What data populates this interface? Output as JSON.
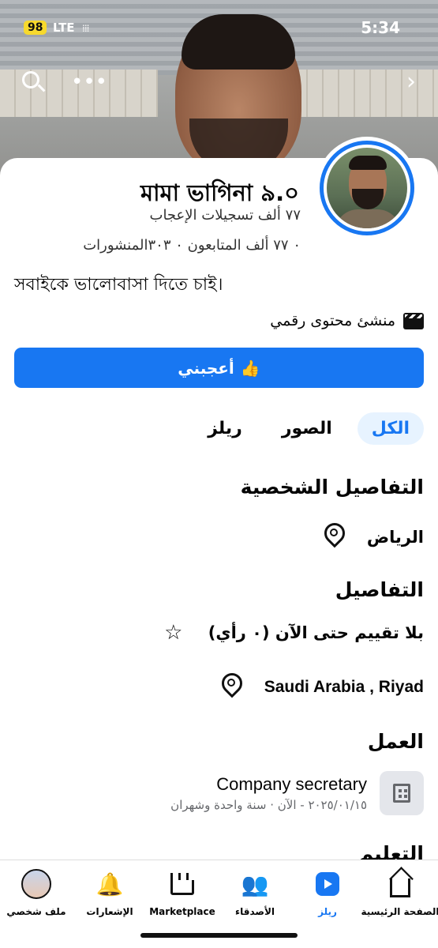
{
  "status_bar": {
    "battery": "98",
    "network": "LTE",
    "signal": "⁞⁞⁞",
    "time": "5:34"
  },
  "profile": {
    "name": "মামা ভাগিনা ৯.০",
    "likes": "٧٧ ألف تسجيلات الإعجاب",
    "stats": "٠ ٧٧ ألف المتابعون ٠ ٣٠٣المنشورات",
    "bio": "সবাইকে ভালোবাসা দিতে চাই।",
    "category": "منشئ محتوى رقمي"
  },
  "actions": {
    "like_label": "أعجبني"
  },
  "tabs": [
    {
      "label": "الكل",
      "active": true
    },
    {
      "label": "الصور",
      "active": false
    },
    {
      "label": "ريلز",
      "active": false
    }
  ],
  "personal_details": {
    "title": "التفاصيل الشخصية",
    "location": "الرياض"
  },
  "details": {
    "title": "التفاصيل",
    "rating": "بلا تقييم حتى الآن (٠ رأي)",
    "address": "Saudi Arabia  , Riyad"
  },
  "work": {
    "title": "العمل",
    "position": "Company secretary",
    "dates": "٢٠٢٥/٠١/١٥ - الآن · سنة واحدة وشهران"
  },
  "education": {
    "title": "التعليم"
  },
  "bottom_nav": {
    "home": "الصفحة الرئيسية",
    "reels": "ريلز",
    "friends": "الأصدقاء",
    "marketplace": "Marketplace",
    "notifications": "الإشعارات",
    "profile": "ملف شخصي"
  },
  "colors": {
    "accent": "#1877f2",
    "battery": "#f7d92d"
  }
}
